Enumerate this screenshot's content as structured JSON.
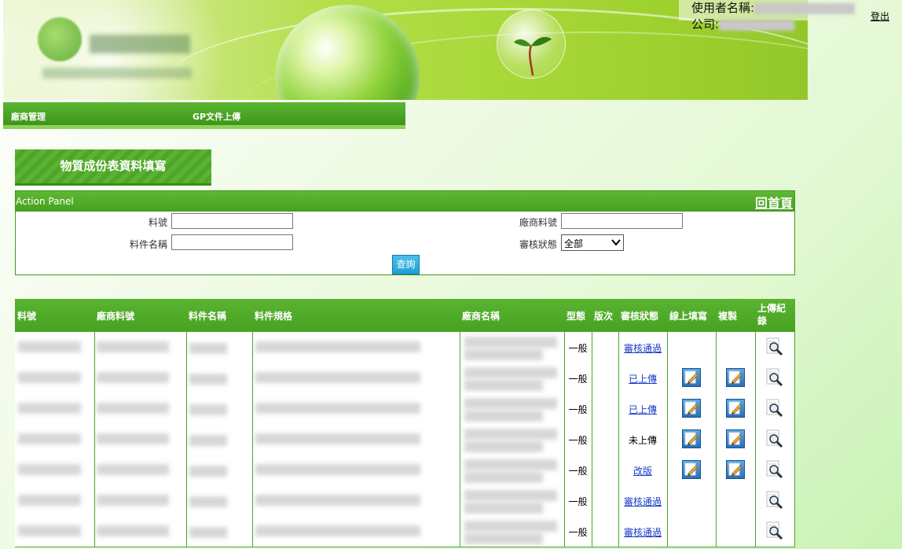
{
  "header": {
    "user_label": "使用者名稱:",
    "company_label": "公司:",
    "logout": "登出"
  },
  "nav": {
    "items": [
      {
        "label": "廠商管理"
      },
      {
        "label": "GP文件上傳"
      }
    ]
  },
  "page": {
    "title": "物質成份表資料填寫"
  },
  "panel": {
    "title": "Action Panel",
    "home_link": "回首頁",
    "fields": {
      "part_no_label": "料號",
      "vendor_part_no_label": "廠商料號",
      "part_name_label": "料件名稱",
      "review_status_label": "審核狀態",
      "part_no_value": "",
      "vendor_part_no_value": "",
      "part_name_value": "",
      "review_status_value": "全部"
    },
    "query_button": "查詢"
  },
  "table": {
    "headers": [
      "料號",
      "廠商料號",
      "料件名稱",
      "料件規格",
      "廠商名稱",
      "型態",
      "版次",
      "審核狀態",
      "線上填寫",
      "複製",
      "上傳紀錄"
    ],
    "rows": [
      {
        "type": "一般",
        "version": "",
        "status": "審核通過",
        "status_link": true,
        "has_edit": false,
        "has_copy": false
      },
      {
        "type": "一般",
        "version": "",
        "status": "已上傳",
        "status_link": true,
        "has_edit": true,
        "has_copy": true
      },
      {
        "type": "一般",
        "version": "",
        "status": "已上傳",
        "status_link": true,
        "has_edit": true,
        "has_copy": true
      },
      {
        "type": "一般",
        "version": "",
        "status": "未上傳",
        "status_link": false,
        "has_edit": true,
        "has_copy": true
      },
      {
        "type": "一般",
        "version": "",
        "status": "改版",
        "status_link": true,
        "has_edit": true,
        "has_copy": true
      },
      {
        "type": "一般",
        "version": "",
        "status": "審核通過",
        "status_link": true,
        "has_edit": false,
        "has_copy": false
      },
      {
        "type": "一般",
        "version": "",
        "status": "審核通過",
        "status_link": true,
        "has_edit": false,
        "has_copy": false
      }
    ]
  },
  "icons": {
    "edit": "edit-pencil-icon",
    "copy": "copy-pencil-icon",
    "view": "magnifier-icon"
  },
  "colors": {
    "header_green": "#4aa524",
    "link_blue": "#1a3cc8",
    "query_blue": "#1f9fd6"
  }
}
